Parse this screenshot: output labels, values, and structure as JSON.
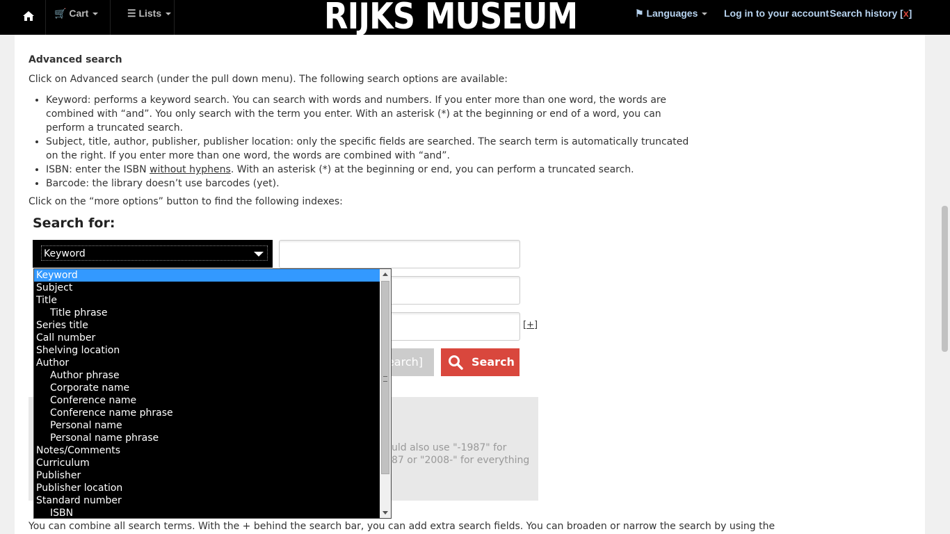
{
  "nav": {
    "home_icon": "home-icon",
    "cart": "Cart",
    "lists": "Lists",
    "logo": "RIJKS MUSEUM",
    "languages": "Languages",
    "login": "Log in to your account",
    "search_history": "Search history",
    "history_clear_open": "[",
    "history_clear_x": "x",
    "history_clear_close": "]"
  },
  "article": {
    "heading": "Advanced search",
    "intro": "Click on Advanced search (under the pull down menu). The following search options are available:",
    "bullets": [
      "Keyword: performs a keyword search. You can search with words and numbers. If you enter more than one word, the words are combined with “and”. You only search with the term you enter. With an asterisk (*) at the beginning or end of a word, you can perform a truncated search.",
      "Subject, title, author, publisher, publisher location: only the specific fields are searched. The search term is automatically truncated on the right. If you enter more than one word, the words are combined with “and”.",
      "Barcode: the library doesn’t use barcodes (yet)."
    ],
    "isbn_prefix": "ISBN: enter the ISBN ",
    "isbn_link": "without hyphens",
    "isbn_suffix": ". With an asterisk (*) at the beginning or end, you can perform a truncated search.",
    "more_options": "Click on the “more options” button to find the following indexes:",
    "bottom": "You can combine all search terms. With the + behind the search bar, you can add extra search fields. You can broaden or narrow the search by using the"
  },
  "search": {
    "title": "Search for:",
    "selected": "Keyword",
    "plus": "[+]",
    "advanced_btn_partial": "earch]",
    "search_btn": "Search",
    "tip_line1": "uld also use \"-1987\" for",
    "tip_line2": "87 or \"2008-\" for everything"
  },
  "dropdown": {
    "items": [
      {
        "label": "Keyword",
        "indent": false,
        "selected": true
      },
      {
        "label": "Subject",
        "indent": false
      },
      {
        "label": "Title",
        "indent": false
      },
      {
        "label": "Title phrase",
        "indent": true
      },
      {
        "label": "Series title",
        "indent": false
      },
      {
        "label": "Call number",
        "indent": false
      },
      {
        "label": "Shelving location",
        "indent": false
      },
      {
        "label": "Author",
        "indent": false
      },
      {
        "label": "Author phrase",
        "indent": true
      },
      {
        "label": "Corporate name",
        "indent": true
      },
      {
        "label": "Conference name",
        "indent": true
      },
      {
        "label": "Conference name phrase",
        "indent": true
      },
      {
        "label": "Personal name",
        "indent": true
      },
      {
        "label": "Personal name phrase",
        "indent": true
      },
      {
        "label": "Notes/Comments",
        "indent": false
      },
      {
        "label": "Curriculum",
        "indent": false
      },
      {
        "label": "Publisher",
        "indent": false
      },
      {
        "label": "Publisher location",
        "indent": false
      },
      {
        "label": "Standard number",
        "indent": false
      },
      {
        "label": "ISBN",
        "indent": true
      }
    ]
  },
  "colors": {
    "accent": "#d9473d",
    "nav_link": "#b7d3ef",
    "selection": "#3399ff"
  }
}
